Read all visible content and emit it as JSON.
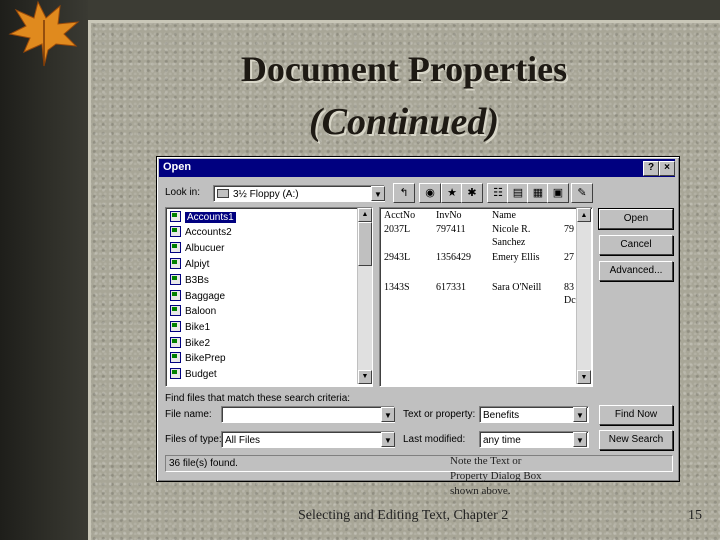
{
  "slide": {
    "title_line1": "Document Properties",
    "title_line2": "(Continued)",
    "footer": "Selecting and Editing Text, Chapter 2",
    "page_number": "15",
    "note": "Note the Text or Property Dialog Box shown above."
  },
  "dialog": {
    "title": "Open",
    "help_btn": "?",
    "close_btn": "×",
    "look_in_label": "Look in:",
    "look_in_value": "3½ Floppy (A:)",
    "toolbar_icons": [
      "up-one-level-icon",
      "web-icon",
      "favorites-icon",
      "add-favorite-icon",
      "list-view-icon",
      "details-view-icon",
      "properties-view-icon",
      "preview-view-icon",
      "commands-icon"
    ],
    "files": [
      "Accounts1",
      "Accounts2",
      "Albucuer",
      "Alpiyt",
      "B3Bs",
      "Baggage",
      "Baloon",
      "Bike1",
      "Bike2",
      "BikePrep",
      "Budget"
    ],
    "preview": {
      "headers": [
        "AcctNo",
        "InvNo",
        "Name"
      ],
      "rows": [
        {
          "acct": "2037L",
          "inv": "797411",
          "name1": "Nicole R.",
          "name2": "Sanchez",
          "extra": "79"
        },
        {
          "acct": "2943L",
          "inv": "1356429",
          "name1": "Emery Ellis",
          "name2": "",
          "extra": "27"
        },
        {
          "acct": "1343S",
          "inv": "617331",
          "name1": "Sara O'Neill",
          "name2": "",
          "extra": "83",
          "extra2": "Dc"
        }
      ]
    },
    "buttons": {
      "open": "Open",
      "cancel": "Cancel",
      "advanced": "Advanced...",
      "find_now": "Find Now",
      "new_search": "New Search"
    },
    "criteria_label": "Find files that match these search criteria:",
    "file_name_label": "File name:",
    "file_name_value": "",
    "text_property_label": "Text or property:",
    "text_property_value": "Benefits",
    "files_type_label": "Files of type:",
    "files_type_value": "All Files",
    "last_modified_label": "Last modified:",
    "last_modified_value": "any time",
    "status": "36 file(s) found."
  }
}
